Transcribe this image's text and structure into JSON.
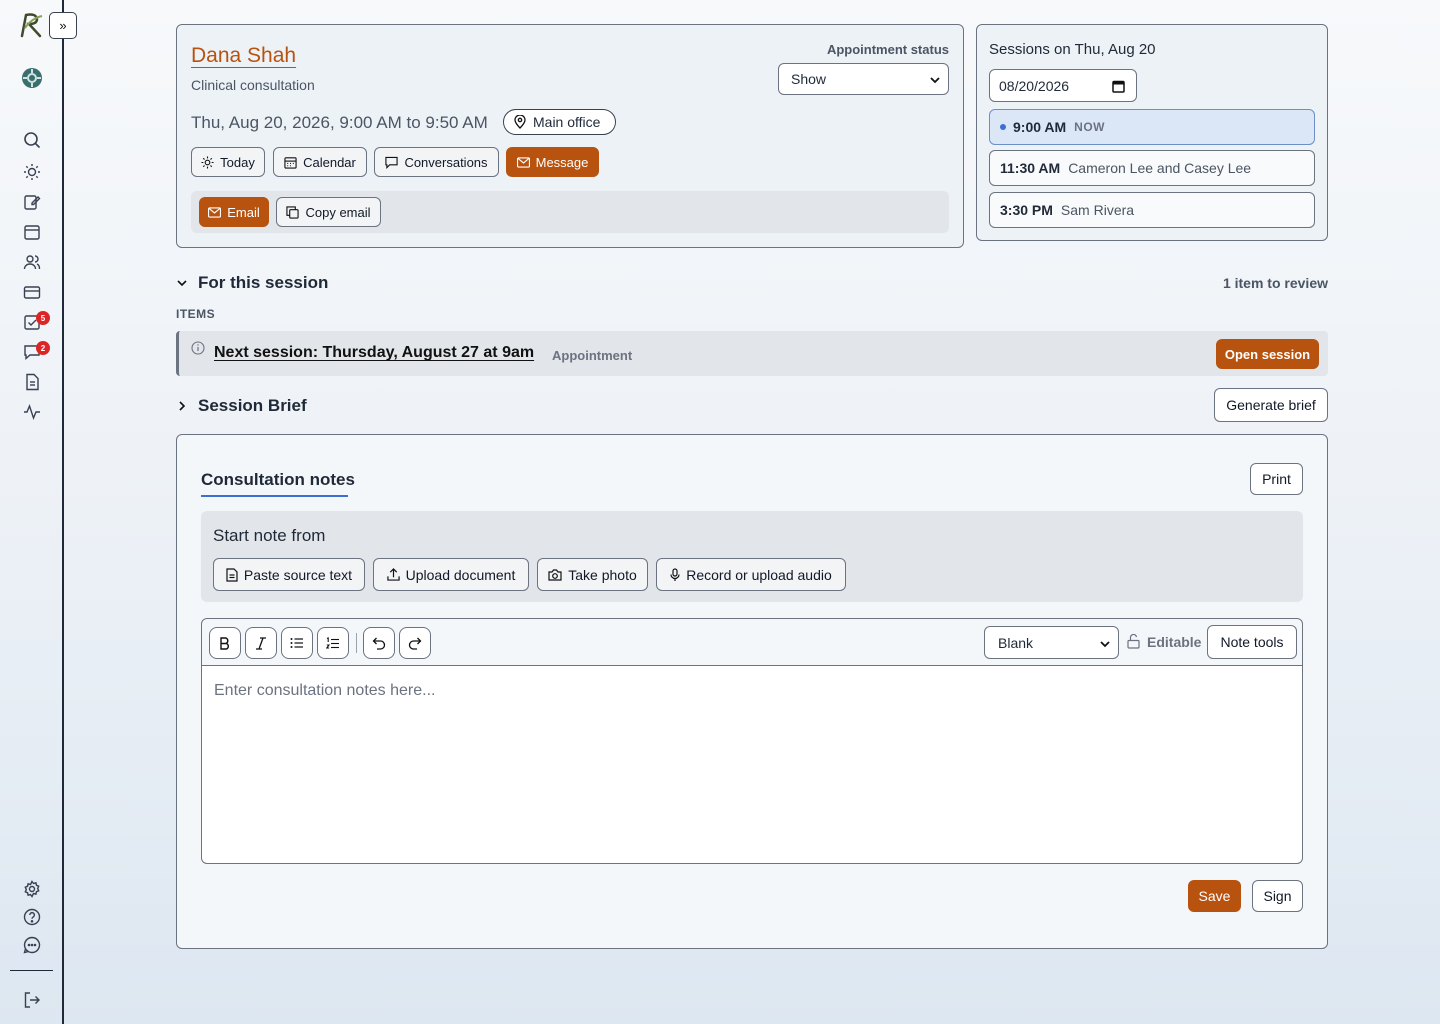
{
  "sidebar": {
    "toggle_label": "»",
    "chat_badge_one": "5",
    "chat_badge_two": "2"
  },
  "appointment": {
    "client_name": "Dana Shah",
    "type": "Clinical consultation",
    "status_label": "Appointment status",
    "status_value": "Show",
    "datetime": "Thu, Aug 20, 2026, 9:00 AM to 9:50 AM",
    "location": "Main office",
    "actions": [
      "Today",
      "Calendar",
      "Conversations",
      "Message"
    ],
    "email_label": "Email",
    "copy_email_label": "Copy email"
  },
  "sessions": {
    "title": "Sessions on Thu, Aug 20",
    "date_value": "08/20/2026",
    "slots": [
      {
        "time": "9:00 AM",
        "who": "NOW"
      },
      {
        "time": "11:30 AM",
        "who": "Cameron Lee and Casey Lee"
      },
      {
        "time": "3:30 PM",
        "who": "Sam Rivera"
      }
    ]
  },
  "for_session": {
    "heading": "For this session",
    "review_count": "1 item to review",
    "items_label": "ITEMS",
    "item_title": "Next session: Thursday, August 27 at 9am",
    "item_type": "Appointment",
    "open_label": "Open session"
  },
  "brief": {
    "heading": "Session Brief",
    "generate_label": "Generate brief"
  },
  "notes": {
    "tab_label": "Consultation notes",
    "print_label": "Print",
    "start_heading": "Start note from",
    "sources": [
      "Paste source text",
      "Upload document",
      "Take photo",
      "Record or upload audio"
    ],
    "template_value": "Blank",
    "editable_label": "Editable",
    "tools_label": "Note tools",
    "placeholder": "Enter consultation notes here...",
    "save_label": "Save",
    "sign_label": "Sign"
  },
  "colors": {
    "accent": "#b8520f",
    "badge": "#dc2626",
    "now": "#3b6fd1"
  }
}
